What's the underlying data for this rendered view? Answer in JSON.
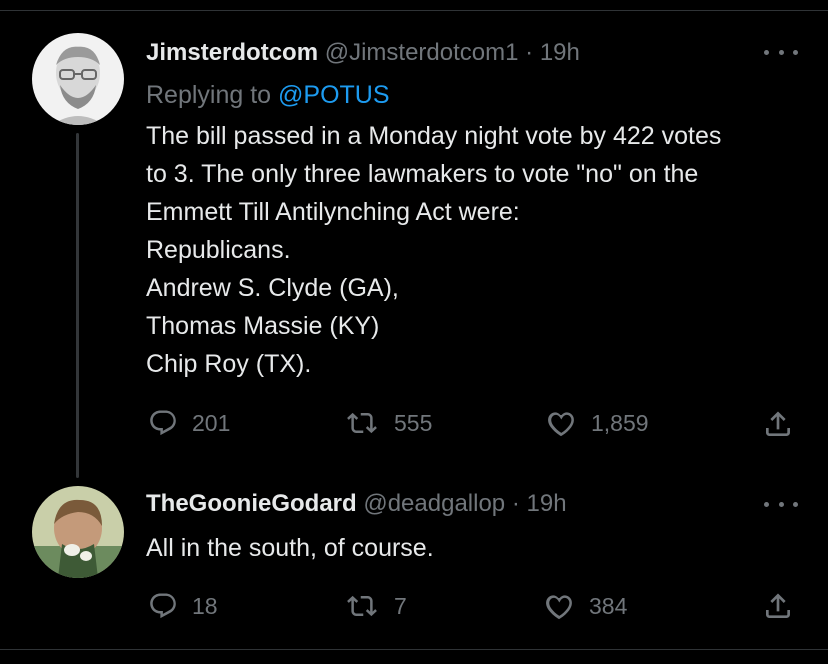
{
  "tweets": [
    {
      "name": "Jimsterdotcom",
      "handle": "@Jimsterdotcom1",
      "separator": "·",
      "time": "19h",
      "replying_prefix": "Replying to",
      "replying_to": "@POTUS",
      "lines": [
        "The bill passed in a Monday night vote by 422 votes",
        "to 3. The only three lawmakers to vote \"no\" on the",
        "Emmett Till Antilynching Act were:",
        "Republicans.",
        "Andrew S. Clyde (GA),",
        "Thomas Massie (KY)",
        "Chip Roy (TX)."
      ],
      "replies": "201",
      "retweets": "555",
      "likes": "1,859"
    },
    {
      "name": "TheGoonieGodard",
      "handle": "@deadgallop",
      "separator": "·",
      "time": "19h",
      "lines": [
        "All in the south, of course."
      ],
      "replies": "18",
      "retweets": "7",
      "likes": "384"
    }
  ],
  "colors": {
    "background": "#000000",
    "text": "#e7e9ea",
    "muted": "#71767b",
    "link": "#1d9bf0",
    "divider": "#2f3336"
  }
}
